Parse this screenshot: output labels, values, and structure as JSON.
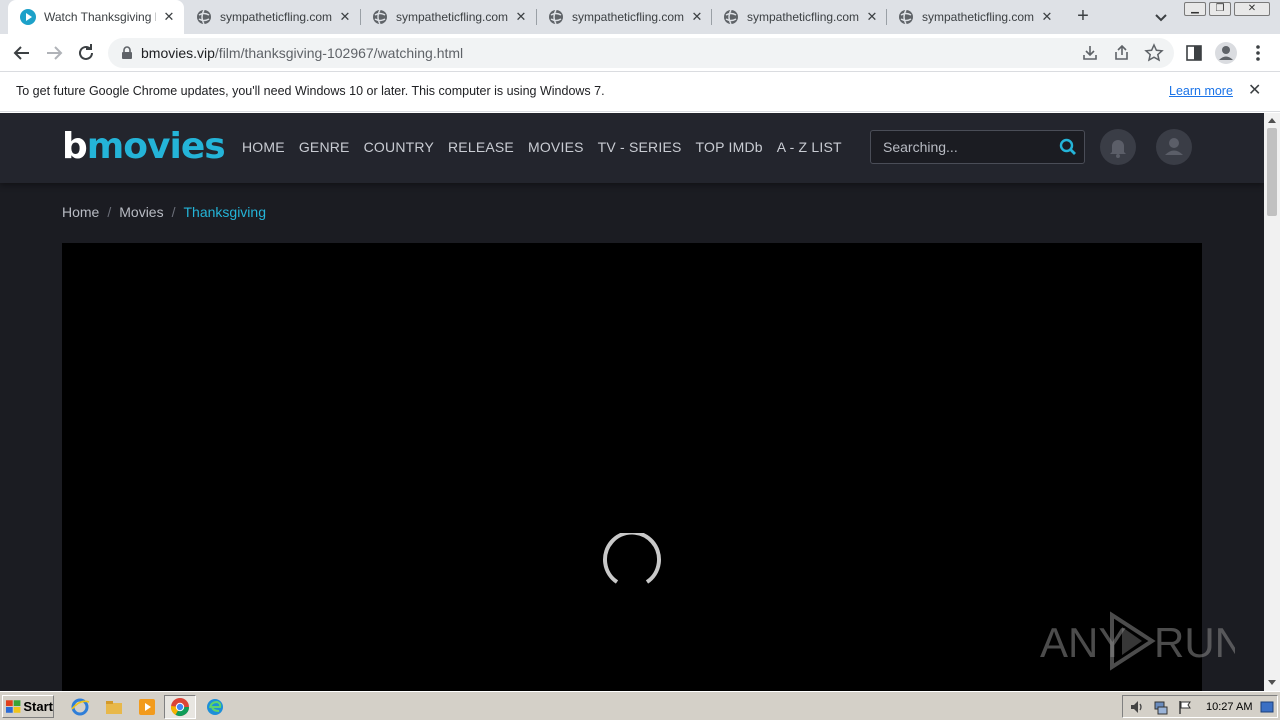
{
  "browser": {
    "tabs": [
      {
        "title": "Watch Thanksgiving Fo",
        "favicon": "bmovies-play-icon",
        "active": true
      },
      {
        "title": "sympatheticfling.com/t",
        "favicon": "globe-icon",
        "active": false
      },
      {
        "title": "sympatheticfling.com/t",
        "favicon": "globe-icon",
        "active": false
      },
      {
        "title": "sympatheticfling.com/t",
        "favicon": "globe-icon",
        "active": false
      },
      {
        "title": "sympatheticfling.com/t",
        "favicon": "globe-icon",
        "active": false
      },
      {
        "title": "sympatheticfling.com/t",
        "favicon": "globe-icon",
        "active": false
      }
    ],
    "address": {
      "domain": "bmovies.vip",
      "path": "/film/thanksgiving-102967/watching.html"
    },
    "infobar": {
      "message": "To get future Google Chrome updates, you'll need Windows 10 or later. This computer is using Windows 7.",
      "link": "Learn more"
    }
  },
  "site": {
    "logo": {
      "first": "b",
      "rest": "movies"
    },
    "nav": [
      "HOME",
      "GENRE",
      "COUNTRY",
      "RELEASE",
      "MOVIES",
      "TV - SERIES",
      "TOP IMDb",
      "A - Z LIST"
    ],
    "search_placeholder": "Searching...",
    "breadcrumb": {
      "home": "Home",
      "section": "Movies",
      "current": "Thanksgiving"
    },
    "player_state": "loading"
  },
  "watermark": {
    "text_left": "ANY",
    "text_right": "RUN"
  },
  "taskbar": {
    "start_label": "Start",
    "clock": "10:27 AM"
  },
  "colors": {
    "accent": "#24b4d8",
    "page_bg": "#1b1c22",
    "header_bg": "#23252d"
  }
}
